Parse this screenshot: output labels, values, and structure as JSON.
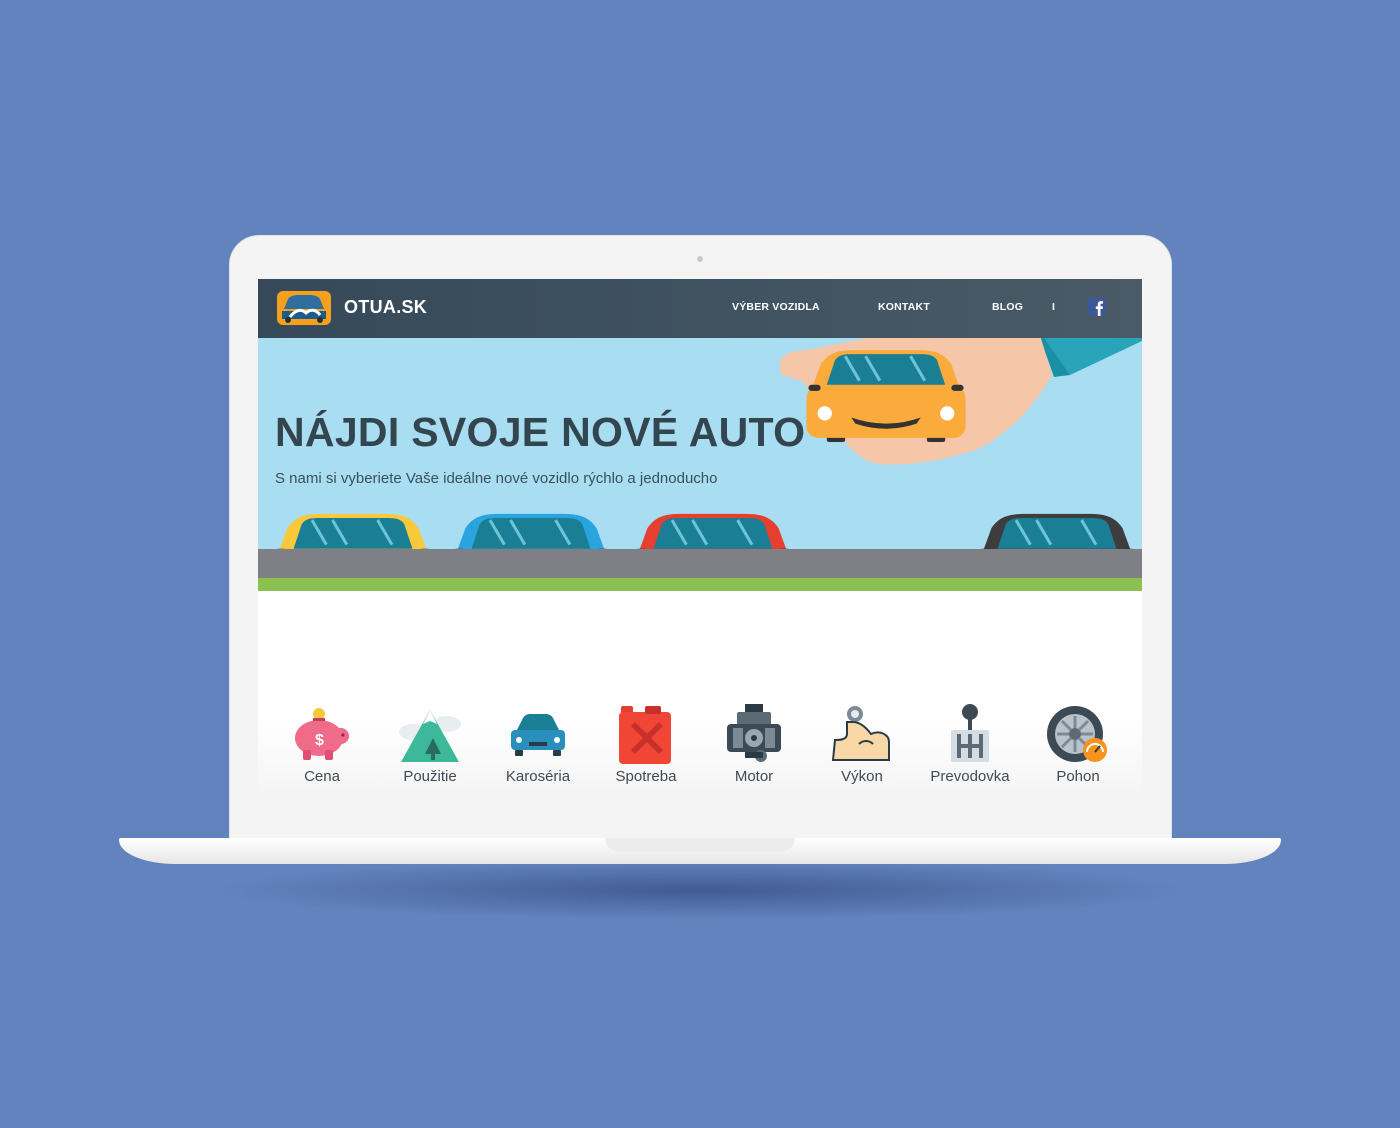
{
  "nav": {
    "brand": "OTUA.SK",
    "links": [
      "VÝBER VOZIDLA",
      "KONTAKT",
      "BLOG"
    ],
    "separator": "I",
    "social": "facebook-icon"
  },
  "hero": {
    "title": "NÁJDI SVOJE NOVÉ AUTO",
    "subtitle": "S nami si vyberiete Vaše ideálne nové vozidlo rýchlo a jednoducho"
  },
  "features": [
    {
      "label": "Cena",
      "icon": "piggy-bank-icon"
    },
    {
      "label": "Použitie",
      "icon": "mountain-icon"
    },
    {
      "label": "Karoséria",
      "icon": "car-body-icon"
    },
    {
      "label": "Spotreba",
      "icon": "fuel-canister-icon"
    },
    {
      "label": "Motor",
      "icon": "engine-icon"
    },
    {
      "label": "Výkon",
      "icon": "muscle-arm-icon"
    },
    {
      "label": "Prevodovka",
      "icon": "gear-shift-icon"
    },
    {
      "label": "Pohon",
      "icon": "wheel-icon"
    }
  ],
  "colors": {
    "background": "#6283be",
    "nav": "#3f525f",
    "sky": "#a9ddf1",
    "grass": "#8cc152",
    "car_yellow": "#f9c93b",
    "car_blue": "#2aa4de",
    "car_red": "#e53f2f",
    "car_black": "#3d3d3d",
    "car_orange": "#fbab3c"
  }
}
